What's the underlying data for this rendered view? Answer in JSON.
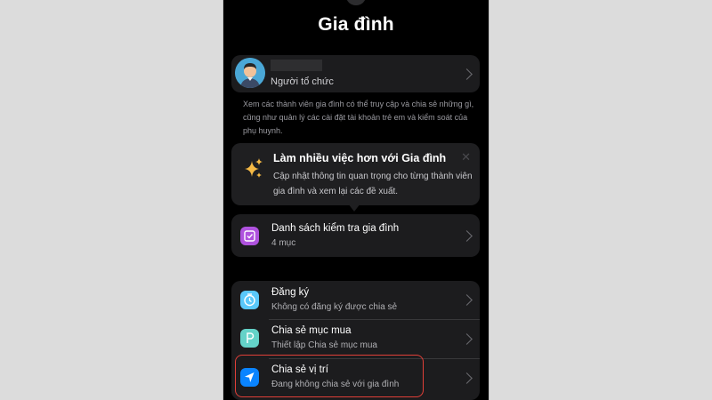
{
  "screen": {
    "title": "Gia đình"
  },
  "organizer": {
    "name": "",
    "role": "Người tổ chức",
    "avatar_icon": "person-avatar-icon"
  },
  "description": "Xem các thành viên gia đình có thể truy cập và chia sẻ những gì, cũng như quản lý các cài đặt tài khoản trẻ em và kiểm soát của phụ huynh.",
  "tip": {
    "title": "Làm nhiều việc hơn với Gia đình",
    "body": "Cập nhật thông tin quan trọng cho từng thành viên gia đình và xem lại các đề xuất.",
    "icon": "sparkles-icon",
    "close_label": "✕"
  },
  "checklist": {
    "title": "Danh sách kiểm tra gia đình",
    "subtitle": "4 mục",
    "icon": "checklist-icon",
    "icon_color": "#af52de"
  },
  "features": [
    {
      "title": "Đăng ký",
      "subtitle": "Không có đăng ký được chia sẻ",
      "icon": "subscription-icon",
      "icon_color": "#5ac8fa"
    },
    {
      "title": "Chia sẻ mục mua",
      "subtitle": "Thiết lập Chia sẻ mục mua",
      "icon": "purchase-sharing-icon",
      "icon_color": "#64d2c8"
    },
    {
      "title": "Chia sẻ vị trí",
      "subtitle": "Đang không chia sẻ với gia đình",
      "icon": "location-arrow-icon",
      "icon_color": "#0a84ff"
    }
  ],
  "colors": {
    "background": "#000000",
    "card": "#1c1c1e",
    "highlight": "#e13f38",
    "sparkles": "#f5b945"
  }
}
